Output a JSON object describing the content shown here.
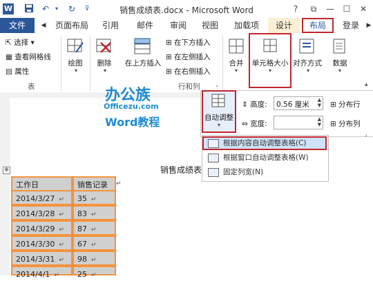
{
  "window": {
    "app_icon": "W",
    "title": "销售成绩表.docx - Microsoft Word",
    "help": "?",
    "restore": "⧉",
    "minimize": "—",
    "maximize": "☐",
    "close": "✕"
  },
  "tabs": {
    "file": "文件",
    "page_layout": "页面布局",
    "references": "引用",
    "mailings": "邮件",
    "review": "审阅",
    "view": "视图",
    "addins": "加载项",
    "design": "设计",
    "layout": "布局",
    "login": "登录"
  },
  "ribbon": {
    "table_group": {
      "select": "选择 ▾",
      "gridlines": "查看网格线",
      "properties": "属性",
      "group_label": "表"
    },
    "draw": "绘图",
    "delete": "删除",
    "insert_above": "在上方插入",
    "insert_below": "在下方插入",
    "insert_left": "在左侧插入",
    "insert_right": "在右侧插入",
    "rows_cols_label": "行和列",
    "merge": "合并",
    "cell_size": "单元格大小",
    "alignment": "对齐方式",
    "data": "数据"
  },
  "watermark": {
    "line1": "办公族",
    "line2": "Officezu.com",
    "line3": "Word教程"
  },
  "cell_panel": {
    "autofit": "自动调整",
    "height_label": "高度:",
    "height_value": "0.56 厘米",
    "width_label": "宽度:",
    "width_value": "",
    "distribute_rows": "分布行",
    "distribute_cols": "分布列"
  },
  "autofit_menu": {
    "content": "根据内容自动调整表格(C)",
    "window": "根据窗口自动调整表格(W)",
    "fixed": "固定列宽(N)"
  },
  "document": {
    "heading": "销售成绩表",
    "table_headers": [
      "工作日",
      "销售记录"
    ],
    "rows": [
      [
        "2014/3/27",
        "35"
      ],
      [
        "2014/3/28",
        "83"
      ],
      [
        "2014/3/29",
        "87"
      ],
      [
        "2014/3/30",
        "67"
      ],
      [
        "2014/3/31",
        "98"
      ],
      [
        "2014/4/1",
        "25"
      ]
    ],
    "cell_mark": "↵"
  }
}
